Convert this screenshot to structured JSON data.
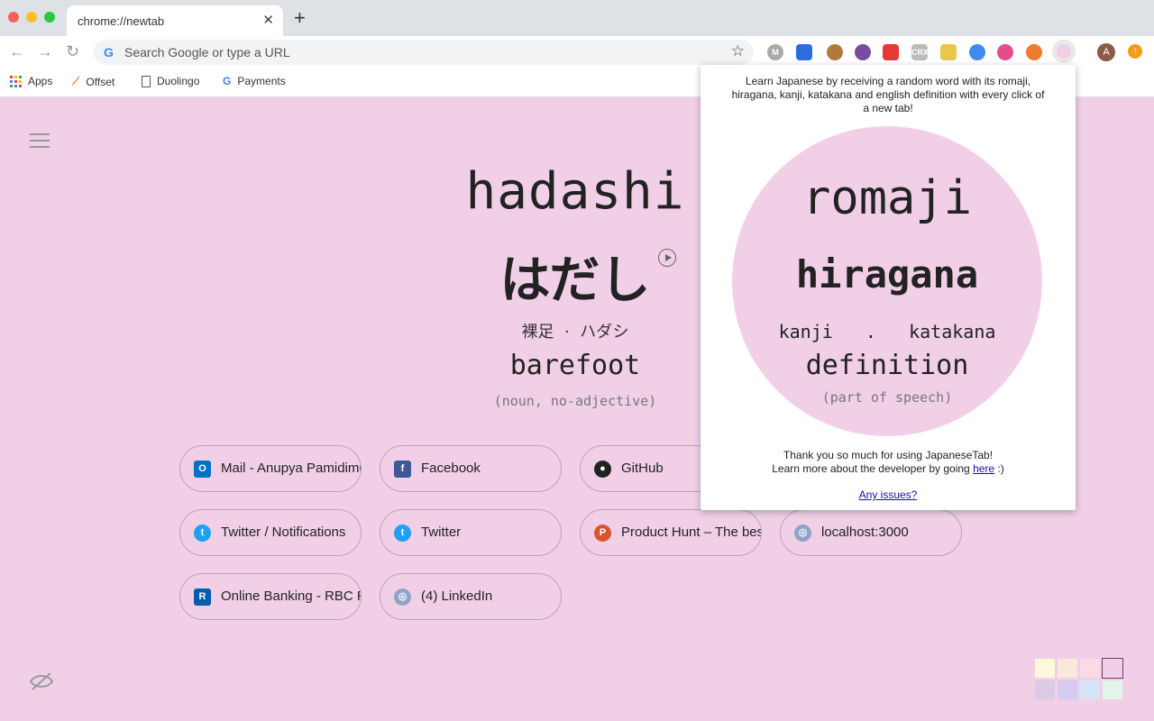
{
  "browser": {
    "tab_title": "chrome://newtab",
    "omnibox_placeholder": "Search Google or type a URL",
    "avatar_letter": "A"
  },
  "bookmarks": [
    {
      "label": "Apps",
      "icon": "apps-grid-icon"
    },
    {
      "label": "Offset",
      "icon": "offset-icon"
    },
    {
      "label": "Duolingo",
      "icon": "page-icon"
    },
    {
      "label": "Payments",
      "icon": "google-icon"
    }
  ],
  "word": {
    "romaji": "hadashi",
    "hiragana": "はだし",
    "kanji": "裸足",
    "separator": "·",
    "katakana": "ハダシ",
    "definition": "barefoot",
    "part_of_speech": "(noun, no-adjective)"
  },
  "shortcuts": [
    {
      "label": "Mail - Anupya Pamidimukkala",
      "icon": "outlook-icon",
      "color": "#0072c6",
      "glyph": "O"
    },
    {
      "label": "Facebook",
      "icon": "facebook-icon",
      "color": "#3b5998",
      "glyph": "f"
    },
    {
      "label": "GitHub",
      "icon": "github-icon",
      "color": "#222222",
      "glyph": "●"
    },
    {
      "label": "Twitter / Notifications",
      "icon": "twitter-icon",
      "color": "#1da1f2",
      "glyph": "t"
    },
    {
      "label": "Twitter",
      "icon": "twitter-icon",
      "color": "#1da1f2",
      "glyph": "t"
    },
    {
      "label": "Product Hunt – The best new products",
      "icon": "producthunt-icon",
      "color": "#da552f",
      "glyph": "P"
    },
    {
      "label": "localhost:3000",
      "icon": "globe-icon",
      "color": "#8fa3c8",
      "glyph": "◎"
    },
    {
      "label": "Online Banking - RBC Royal Bank",
      "icon": "rbc-icon",
      "color": "#005daa",
      "glyph": "R"
    },
    {
      "label": "(4) LinkedIn",
      "icon": "globe-icon",
      "color": "#8fa3c8",
      "glyph": "◎"
    }
  ],
  "popup": {
    "intro": "Learn Japanese by receiving a random word with its romaji, hiragana, kanji, katakana and english definition with every click of a new tab!",
    "romaji": "romaji",
    "hiragana": "hiragana",
    "kanji": "kanji",
    "separator": ".",
    "katakana": "katakana",
    "definition": "definition",
    "part_of_speech": "(part of speech)",
    "thanks": "Thank you so much for using JapaneseTab!",
    "learn_more": "Learn more about the developer by going",
    "here_link": "here",
    "smiley": ":)",
    "issues_link": "Any issues?"
  },
  "theme_swatches": [
    "#fdf8dc",
    "#fbe8dd",
    "#f9dbe6",
    "#f1d0e7",
    "#dcc9e3",
    "#d5cbf0",
    "#d6e3f5",
    "#e1f5eb"
  ],
  "accent_color": "#f1d0e7"
}
